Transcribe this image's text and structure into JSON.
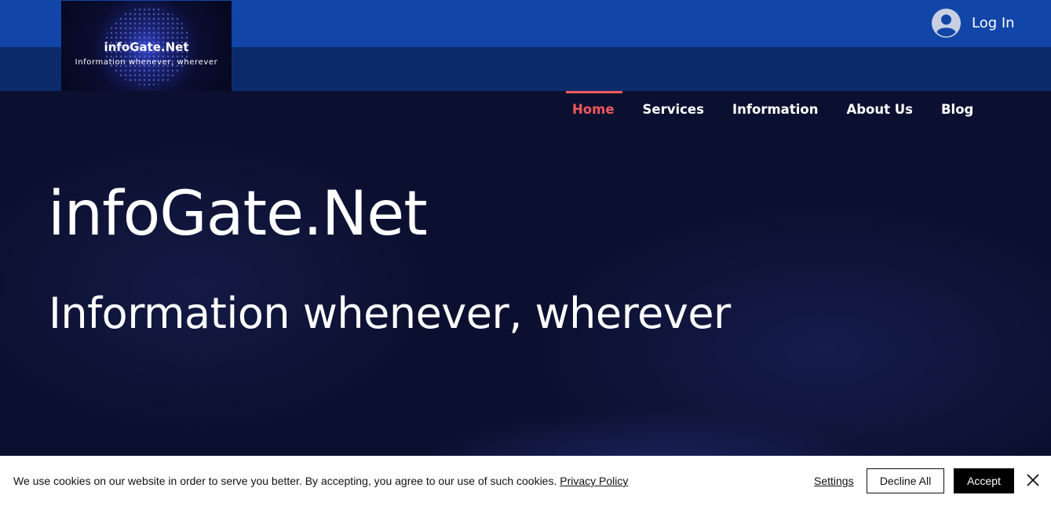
{
  "brand": {
    "logo_title": "infoGate.Net",
    "logo_subtitle": "Information whenever, wherever"
  },
  "header": {
    "login_label": "Log In",
    "login_icon": "user-avatar-icon"
  },
  "nav": {
    "items": [
      {
        "label": "Home",
        "active": true
      },
      {
        "label": "Services",
        "active": false
      },
      {
        "label": "Information",
        "active": false
      },
      {
        "label": "About Us",
        "active": false
      },
      {
        "label": "Blog",
        "active": false
      }
    ],
    "active_color": "#f0595a"
  },
  "hero": {
    "title": "infoGate.Net",
    "subtitle": "Information whenever, wherever"
  },
  "cookie_banner": {
    "text": "We use cookies on our website in order to serve you better. By accepting, you agree to our use of such cookies.",
    "privacy_link": "Privacy Policy",
    "settings_link": "Settings",
    "decline_label": "Decline All",
    "accept_label": "Accept",
    "close_icon": "close-icon"
  },
  "colors": {
    "topbar": "#1245a8",
    "subbar": "#0c2b6b",
    "hero_bg": "#0c1030"
  }
}
